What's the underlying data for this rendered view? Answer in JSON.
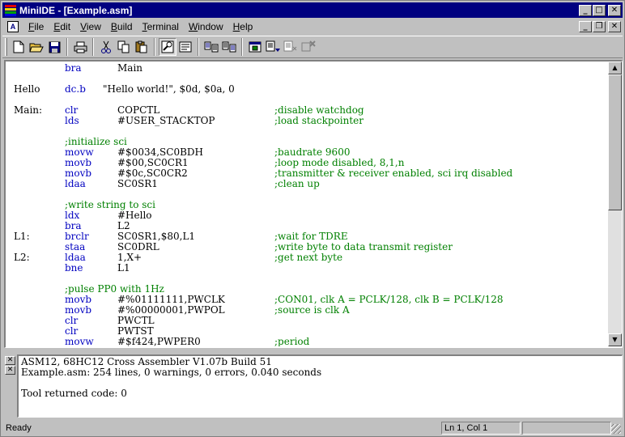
{
  "window": {
    "title": "MiniIDE - [Example.asm]",
    "accent": "#000080",
    "buttons": {
      "minimize": "_",
      "maximize": "□",
      "close": "✕",
      "restore": "❐"
    }
  },
  "menu": {
    "doc_icon": "A",
    "items": [
      {
        "label": "File",
        "access": "F"
      },
      {
        "label": "Edit",
        "access": "E"
      },
      {
        "label": "View",
        "access": "V"
      },
      {
        "label": "Build",
        "access": "B"
      },
      {
        "label": "Terminal",
        "access": "T"
      },
      {
        "label": "Window",
        "access": "W"
      },
      {
        "label": "Help",
        "access": "H"
      }
    ]
  },
  "toolbar": {
    "icons": [
      "new-file-icon",
      "open-folder-icon",
      "save-icon",
      "print-icon",
      "cut-icon",
      "copy-icon",
      "paste-icon",
      "find-icon",
      "properties-icon",
      "compile-icon",
      "build-icon",
      "terminal-icon",
      "download-icon",
      "debug-icon",
      "stop-icon"
    ]
  },
  "editor": {
    "comment_color": "#008000",
    "keyword_color": "#0000c0",
    "lines": [
      {
        "label": "",
        "op": "bra",
        "arg": "Main",
        "cmt": ""
      },
      {
        "label": "",
        "op": "",
        "arg": "",
        "cmt": ""
      },
      {
        "label": "Hello",
        "op": "dc.b",
        "arg": "",
        "cmt": "",
        "raw": "\"Hello world!\", $0d, $0a, 0"
      },
      {
        "label": "",
        "op": "",
        "arg": "",
        "cmt": ""
      },
      {
        "label": "Main:",
        "op": "clr",
        "arg": "COPCTL",
        "cmt": ";disable watchdog"
      },
      {
        "label": "",
        "op": "lds",
        "arg": "#USER_STACKTOP",
        "cmt": ";load stackpointer"
      },
      {
        "label": "",
        "op": "",
        "arg": "",
        "cmt": ""
      },
      {
        "label": "",
        "full": ";initialize sci"
      },
      {
        "label": "",
        "op": "movw",
        "arg": "#$0034,SC0BDH",
        "cmt": ";baudrate 9600"
      },
      {
        "label": "",
        "op": "movb",
        "arg": "#$00,SC0CR1",
        "cmt": ";loop mode disabled, 8,1,n"
      },
      {
        "label": "",
        "op": "movb",
        "arg": "#$0c,SC0CR2",
        "cmt": ";transmitter & receiver enabled, sci irq disabled"
      },
      {
        "label": "",
        "op": "ldaa",
        "arg": "SC0SR1",
        "cmt": ";clean up"
      },
      {
        "label": "",
        "op": "",
        "arg": "",
        "cmt": ""
      },
      {
        "label": "",
        "full": ";write string to sci"
      },
      {
        "label": "",
        "op": "ldx",
        "arg": "#Hello",
        "cmt": ""
      },
      {
        "label": "",
        "op": "bra",
        "arg": "L2",
        "cmt": ""
      },
      {
        "label": "L1:",
        "op": "brclr",
        "arg": "SC0SR1,$80,L1",
        "cmt": ";wait for TDRE"
      },
      {
        "label": "",
        "op": "staa",
        "arg": "SC0DRL",
        "cmt": ";write byte to data transmit register"
      },
      {
        "label": "L2:",
        "op": "ldaa",
        "arg": "1,X+",
        "cmt": ";get next byte"
      },
      {
        "label": "",
        "op": "bne",
        "arg": "L1",
        "cmt": ""
      },
      {
        "label": "",
        "op": "",
        "arg": "",
        "cmt": ""
      },
      {
        "label": "",
        "full": ";pulse PP0 with 1Hz"
      },
      {
        "label": "",
        "op": "movb",
        "arg": "#%01111111,PWCLK",
        "cmt": ";CON01, clk A = PCLK/128, clk B = PCLK/128"
      },
      {
        "label": "",
        "op": "movb",
        "arg": "#%00000001,PWPOL",
        "cmt": ";source is clk A"
      },
      {
        "label": "",
        "op": "clr",
        "arg": "PWCTL",
        "cmt": ""
      },
      {
        "label": "",
        "op": "clr",
        "arg": "PWTST",
        "cmt": ""
      },
      {
        "label": "",
        "op": "movw",
        "arg": "#$f424,PWPER0",
        "cmt": ";period"
      }
    ]
  },
  "output": {
    "lines": [
      "ASM12, 68HC12 Cross Assembler V1.07b Build 51",
      "Example.asm: 254 lines, 0 warnings, 0 errors, 0.040 seconds",
      "",
      "Tool returned code: 0"
    ]
  },
  "status": {
    "text": "Ready",
    "position": "Ln 1, Col 1"
  }
}
